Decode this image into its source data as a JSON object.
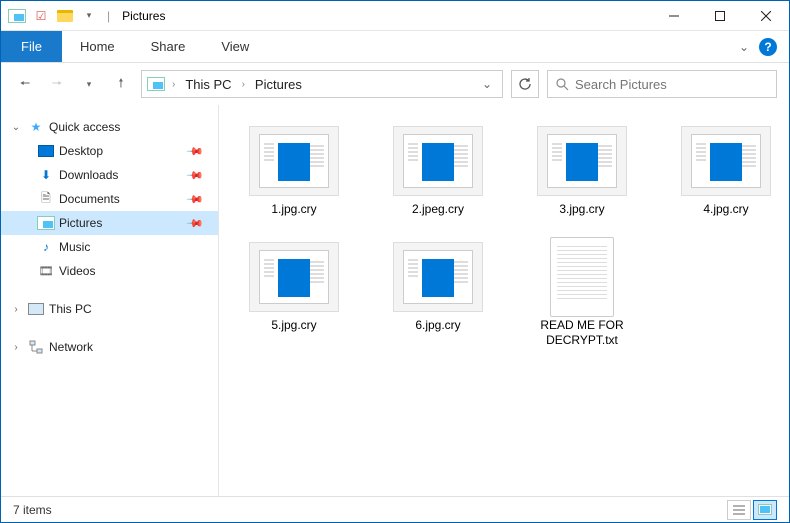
{
  "window": {
    "title": "Pictures"
  },
  "ribbon": {
    "file": "File",
    "tabs": [
      "Home",
      "Share",
      "View"
    ]
  },
  "address": {
    "crumbs": [
      "This PC",
      "Pictures"
    ]
  },
  "search": {
    "placeholder": "Search Pictures"
  },
  "sidebar": {
    "quick_access": {
      "label": "Quick access",
      "items": [
        {
          "label": "Desktop",
          "pinned": true,
          "icon": "desktop"
        },
        {
          "label": "Downloads",
          "pinned": true,
          "icon": "downloads"
        },
        {
          "label": "Documents",
          "pinned": true,
          "icon": "documents"
        },
        {
          "label": "Pictures",
          "pinned": true,
          "icon": "pictures",
          "selected": true
        },
        {
          "label": "Music",
          "pinned": false,
          "icon": "music"
        },
        {
          "label": "Videos",
          "pinned": false,
          "icon": "videos"
        }
      ]
    },
    "this_pc": {
      "label": "This PC"
    },
    "network": {
      "label": "Network"
    }
  },
  "files": [
    {
      "name": "1.jpg.cry",
      "type": "image"
    },
    {
      "name": "2.jpeg.cry",
      "type": "image"
    },
    {
      "name": "3.jpg.cry",
      "type": "image"
    },
    {
      "name": "4.jpg.cry",
      "type": "image"
    },
    {
      "name": "5.jpg.cry",
      "type": "image"
    },
    {
      "name": "6.jpg.cry",
      "type": "image"
    },
    {
      "name": "READ ME FOR DECRYPT.txt",
      "type": "text"
    }
  ],
  "status": {
    "count_label": "7 items"
  }
}
